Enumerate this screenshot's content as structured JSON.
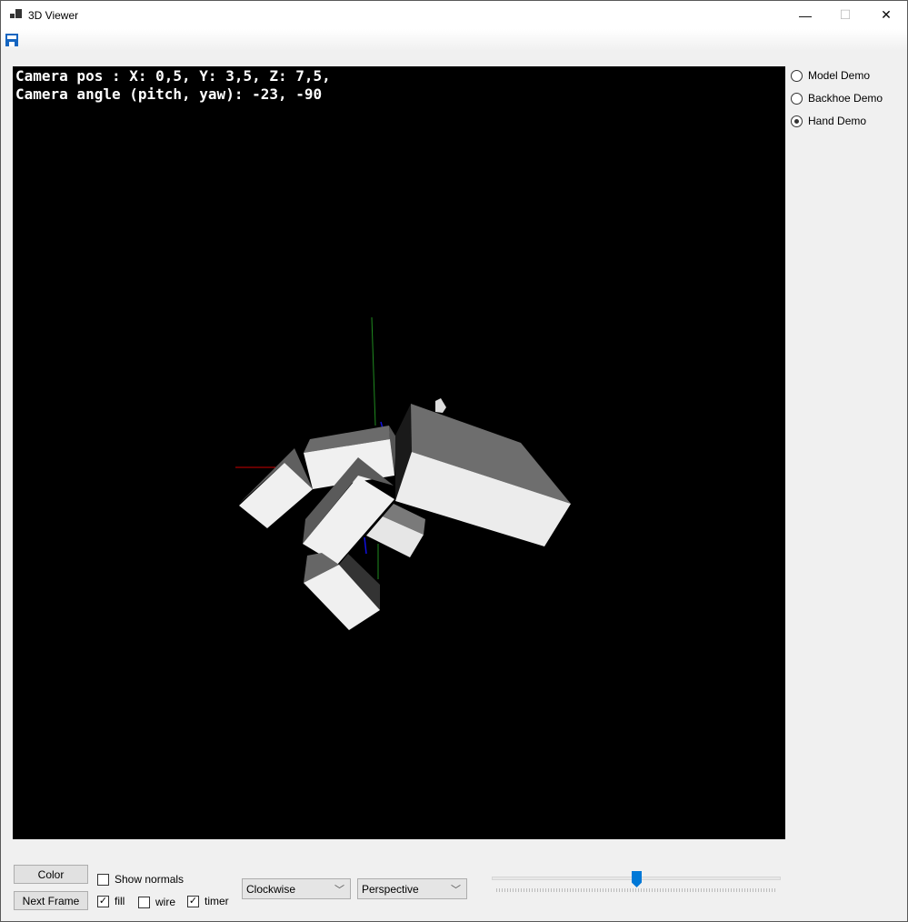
{
  "window": {
    "title": "3D Viewer",
    "minimize": "—",
    "maximize": "☐",
    "close": "✕"
  },
  "toolbar": {
    "save_icon": "save-icon"
  },
  "viewport": {
    "camera_pos": "Camera pos : X: 0,5, Y: 3,5, Z: 7,5,",
    "camera_angle": "Camera angle (pitch, yaw): -23, -90",
    "background": "#000000",
    "axis_colors": {
      "x": "#cc0000",
      "y": "#1f8a1f",
      "z": "#1010dd"
    }
  },
  "demos": [
    {
      "label": "Model Demo",
      "selected": false
    },
    {
      "label": "Backhoe Demo",
      "selected": false
    },
    {
      "label": "Hand Demo",
      "selected": true
    }
  ],
  "controls": {
    "color_button": "Color",
    "next_frame_button": "Next Frame",
    "show_normals": {
      "label": "Show normals",
      "checked": false
    },
    "fill": {
      "label": "fill",
      "checked": true
    },
    "wire": {
      "label": "wire",
      "checked": false
    },
    "timer": {
      "label": "timer",
      "checked": true
    },
    "winding_select": "Clockwise",
    "projection_select": "Perspective",
    "slider_value_fraction": 0.5,
    "accent": "#0078d7"
  }
}
